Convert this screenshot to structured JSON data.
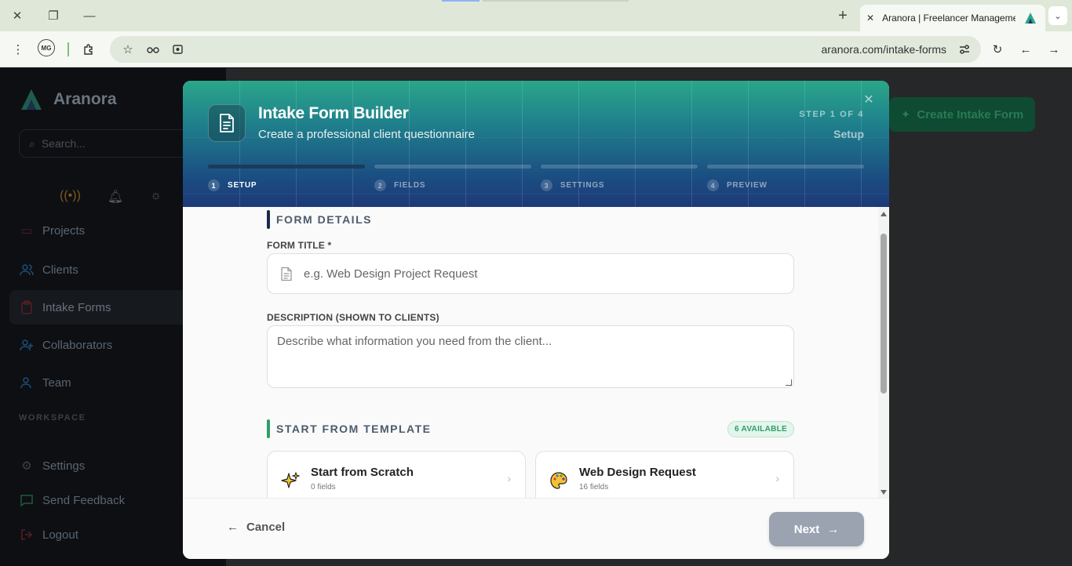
{
  "browser": {
    "tab_title": "Aranora | Freelancer Management",
    "url": "aranora.com/intake-forms",
    "profile_initials": "MG"
  },
  "app": {
    "brand": "Aranora",
    "search_placeholder": "Search...",
    "nav": [
      {
        "label": "Projects",
        "icon": "folder-icon"
      },
      {
        "label": "Clients",
        "icon": "users-icon"
      },
      {
        "label": "Intake Forms",
        "icon": "clipboard-icon",
        "active": true
      },
      {
        "label": "Collaborators",
        "icon": "user-plus-icon"
      },
      {
        "label": "Team",
        "icon": "team-icon"
      }
    ],
    "workspace_label": "WORKSPACE",
    "workspace_nav": [
      {
        "label": "Settings",
        "icon": "gear-icon"
      },
      {
        "label": "Send Feedback",
        "icon": "message-icon"
      },
      {
        "label": "Logout",
        "icon": "logout-icon"
      }
    ],
    "create_button": "Create Intake Form"
  },
  "modal": {
    "title": "Intake Form Builder",
    "subtitle": "Create a professional client questionnaire",
    "step_indicator": "STEP 1 OF 4",
    "step_name": "Setup",
    "steps": [
      {
        "num": "1",
        "label": "SETUP",
        "active": true
      },
      {
        "num": "2",
        "label": "FIELDS",
        "active": false
      },
      {
        "num": "3",
        "label": "SETTINGS",
        "active": false
      },
      {
        "num": "4",
        "label": "PREVIEW",
        "active": false
      }
    ],
    "form_details": {
      "heading": "FORM DETAILS",
      "title_label": "FORM TITLE *",
      "title_placeholder": "e.g. Web Design Project Request",
      "description_label": "DESCRIPTION (SHOWN TO CLIENTS)",
      "description_placeholder": "Describe what information you need from the client..."
    },
    "templates": {
      "heading": "START FROM TEMPLATE",
      "badge": "6 AVAILABLE",
      "items": [
        {
          "name": "Start from Scratch",
          "fields": "0 fields",
          "icon": "sparkles-icon"
        },
        {
          "name": "Web Design Request",
          "fields": "16 fields",
          "icon": "palette-icon"
        }
      ]
    },
    "cancel_label": "Cancel",
    "next_label": "Next"
  },
  "colors": {
    "accent_green": "#2e9e68",
    "next_disabled": "#9ba2b0",
    "header_gradient_top": "#2aa68a",
    "header_gradient_bottom": "#1c3978"
  }
}
